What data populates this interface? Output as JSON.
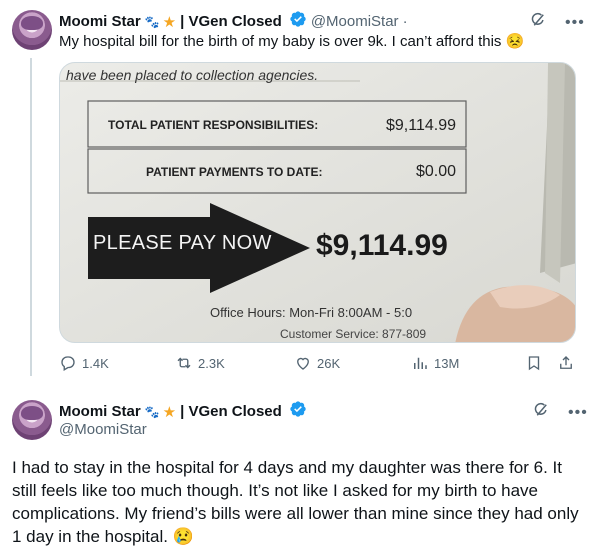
{
  "tweet1": {
    "display_name": "Moomi Star",
    "name_suffix": "| VGen Closed",
    "handle": "@MoomiStar",
    "separator": "·",
    "text": "My hospital bill for the birth of my baby is over 9k. I can’t afford this 😣",
    "media": {
      "header_line": "have been placed to collection agencies.",
      "row1_label": "TOTAL PATIENT RESPONSIBILITIES:",
      "row1_value": "$9,114.99",
      "row2_label": "PATIENT PAYMENTS TO DATE:",
      "row2_value": "$0.00",
      "arrow_text": "PLEASE PAY NOW",
      "pay_amount": "$9,114.99",
      "office_hours": "Office Hours: Mon-Fri 8:00AM - 5:0",
      "customer_service": "Customer Service: 877-809"
    },
    "actions": {
      "reply_count": "1.4K",
      "repost_count": "2.3K",
      "like_count": "26K",
      "view_count": "13M"
    }
  },
  "tweet2": {
    "display_name": "Moomi Star",
    "name_suffix": "| VGen Closed",
    "handle": "@MoomiStar",
    "text": "I had to stay in the hospital for 4 days and my daughter was there for 6. It still feels like too much though. It’s not like I asked for my birth to have complications. My friend’s bills were all lower than mine since they had only 1 day in the hospital. 😢"
  },
  "colors": {
    "verified_blue": "#1d9bf0",
    "text_primary": "#0f1419",
    "text_secondary": "#536471",
    "divider": "#cfd9de"
  },
  "icons": [
    "grok-icon",
    "more-icon",
    "verified-icon",
    "reply-icon",
    "repost-icon",
    "like-icon",
    "views-icon",
    "bookmark-icon",
    "share-icon"
  ]
}
